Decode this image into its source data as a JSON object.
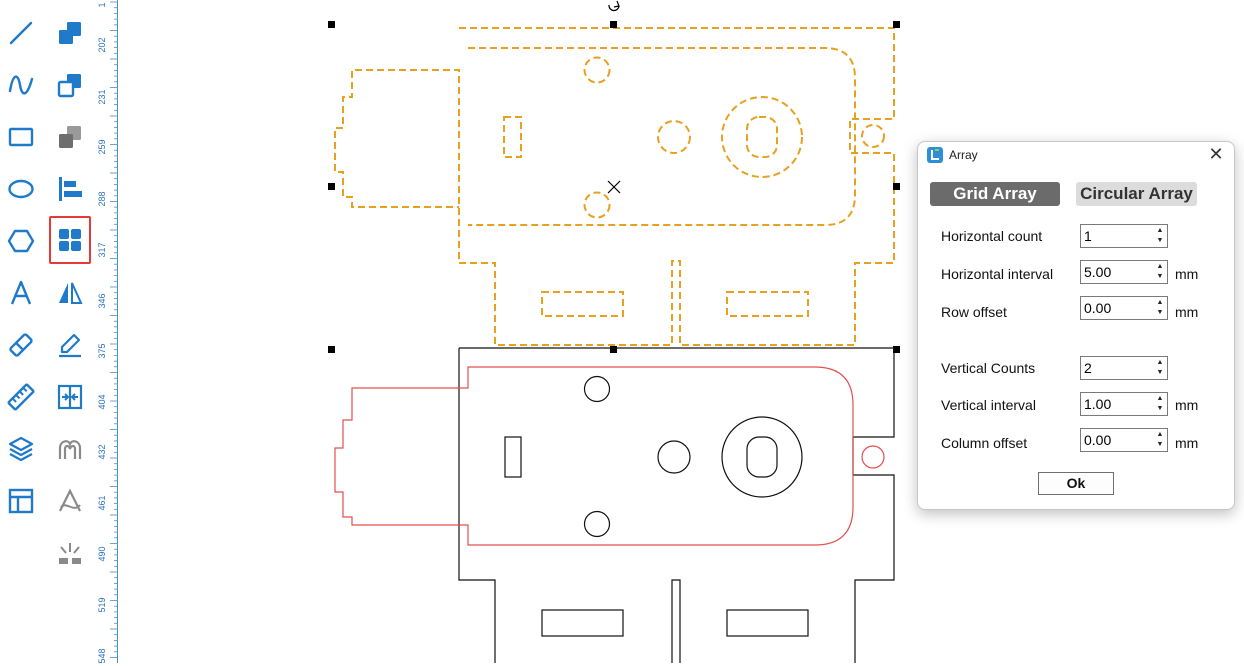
{
  "toolbar": {
    "left_tools": [
      "line-tool",
      "curve-tool",
      "rectangle-tool",
      "ellipse-tool",
      "polygon-tool",
      "text-tool",
      "eraser-tool",
      "measure-tool",
      "layers-tool",
      "layout-tool"
    ],
    "right_tools": [
      "combine-tool",
      "copy-tool",
      "group-tool",
      "align-tool",
      "array-tool",
      "mirror-tool",
      "edit-path-tool",
      "distribute-tool",
      "offset-tool",
      "node-tool",
      "laser-tool"
    ],
    "selected_tool": "array-tool",
    "accent_color": "#1f7ac9"
  },
  "ruler": {
    "labels": [
      "1",
      "202",
      "231",
      "259",
      "288",
      "317",
      "346",
      "375",
      "404",
      "432",
      "461",
      "490",
      "519",
      "548"
    ]
  },
  "dialog": {
    "title": "Array",
    "close_label": "✕",
    "tabs": {
      "grid": "Grid Array",
      "circular": "Circular Array",
      "active": "Grid Array"
    },
    "fields": {
      "horizontal_count": {
        "label": "Horizontal count",
        "value": "1",
        "unit": ""
      },
      "horizontal_interval": {
        "label": "Horizontal interval",
        "value": "5.00",
        "unit": "mm"
      },
      "row_offset": {
        "label": "Row offset",
        "value": "0.00",
        "unit": "mm"
      },
      "vertical_counts": {
        "label": "Vertical Counts",
        "value": "2",
        "unit": ""
      },
      "vertical_interval": {
        "label": "Vertical interval",
        "value": "1.00",
        "unit": "mm"
      },
      "column_offset": {
        "label": "Column offset",
        "value": "0.00",
        "unit": "mm"
      }
    },
    "ok_label": "Ok"
  },
  "colors": {
    "selection_outline": "#e8a020",
    "part_outline": "#111111",
    "red_outline": "#e05050"
  }
}
